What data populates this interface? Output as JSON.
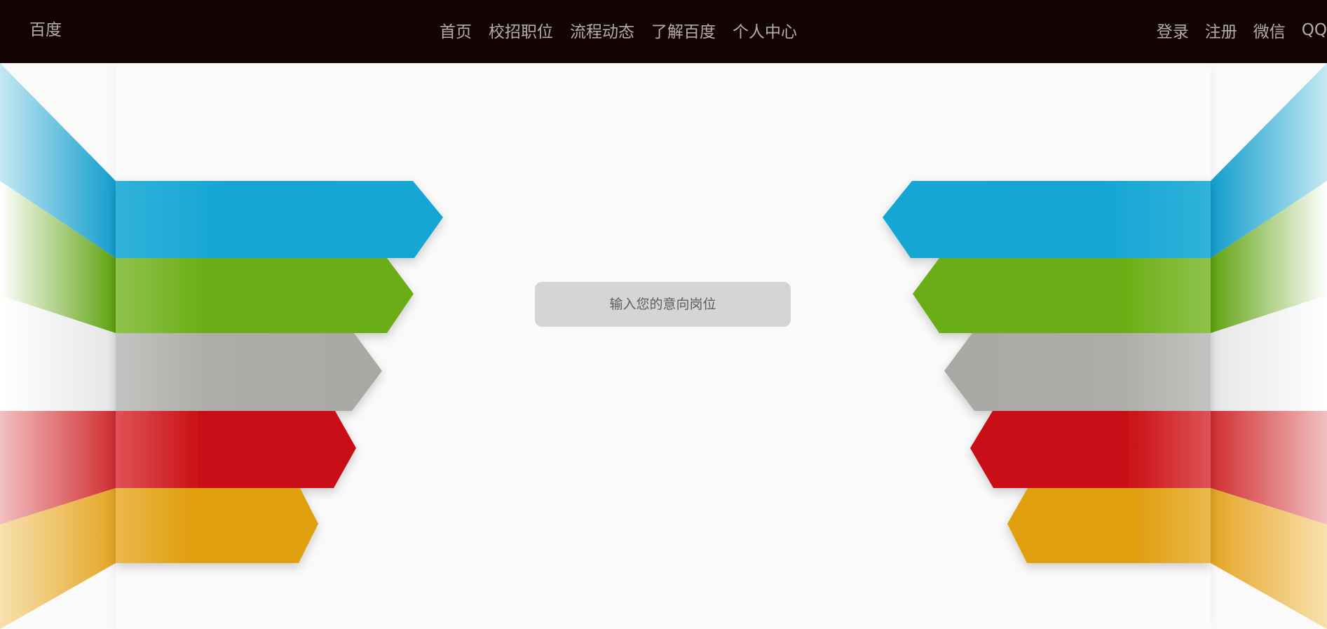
{
  "header": {
    "brand": "百度",
    "nav_main": [
      {
        "label": "首页"
      },
      {
        "label": "校招职位"
      },
      {
        "label": "流程动态"
      },
      {
        "label": "了解百度"
      },
      {
        "label": "个人中心"
      }
    ],
    "nav_account": [
      {
        "label": "登录"
      },
      {
        "label": "注册"
      },
      {
        "label": "微信"
      },
      {
        "label": "QQ"
      }
    ]
  },
  "search": {
    "placeholder": "输入您的意向岗位",
    "value": ""
  },
  "colors": {
    "header_bg": "#130404",
    "nav_text": "#b6abab",
    "ribbon_blue": "#12a6d3",
    "ribbon_green": "#6aad14",
    "ribbon_gray": "#aeaca8",
    "ribbon_red": "#c91013",
    "ribbon_orange": "#e0a011"
  }
}
